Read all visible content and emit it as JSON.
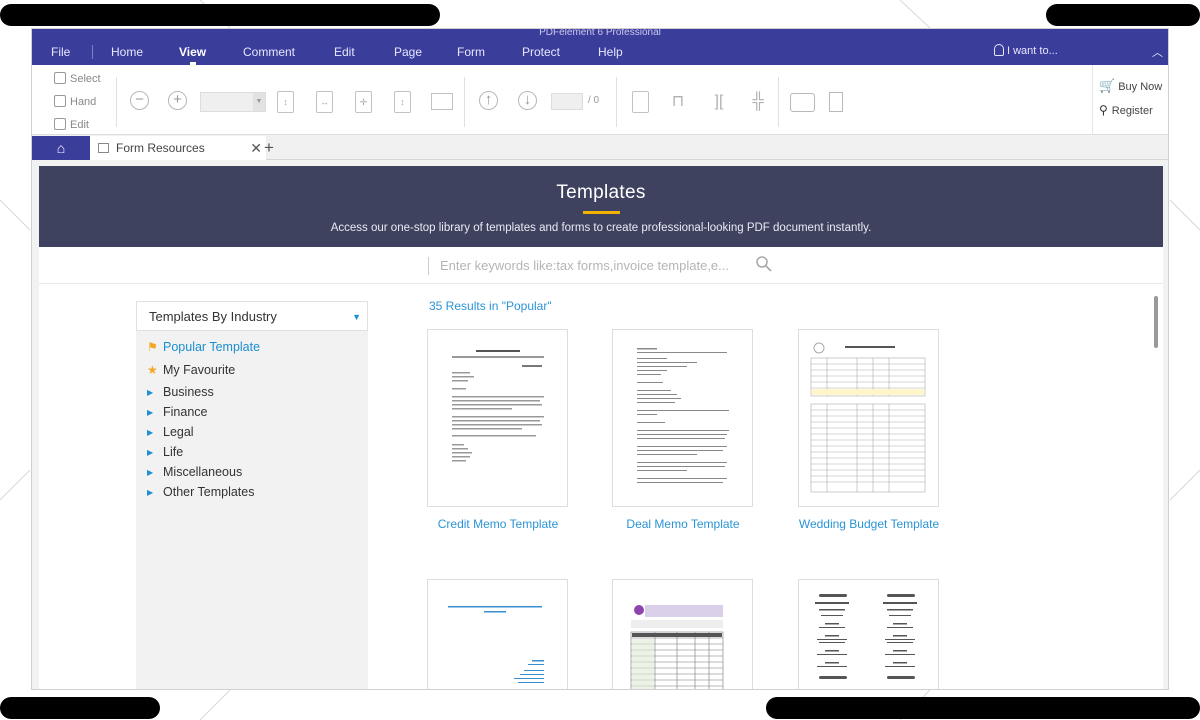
{
  "app": {
    "title": "PDFelement 6 Professional"
  },
  "menu": {
    "items": [
      "File",
      "Home",
      "View",
      "Comment",
      "Edit",
      "Page",
      "Form",
      "Protect",
      "Help"
    ],
    "active": "View",
    "i_want": "I want to..."
  },
  "toolbar": {
    "select_label": "Select",
    "hand_label": "Hand",
    "edit_label": "Edit",
    "page_count": "/ 0",
    "buy_now": "Buy Now",
    "register": "Register"
  },
  "tabs": {
    "doc_tab": "Form Resources"
  },
  "hero": {
    "title": "Templates",
    "subtitle": "Access our one-stop library of templates and forms to create professional-looking PDF document instantly."
  },
  "search": {
    "placeholder": "Enter keywords like:tax forms,invoice template,e..."
  },
  "sidebar": {
    "dropdown_label": "Templates By Industry",
    "categories": [
      "Popular Template",
      "My Favourite",
      "Business",
      "Finance",
      "Legal",
      "Life",
      "Miscellaneous",
      "Other Templates"
    ]
  },
  "results": {
    "summary": "35  Results in \"Popular\""
  },
  "templates": [
    {
      "name": "Credit Memo Template"
    },
    {
      "name": "Deal Memo Template"
    },
    {
      "name": "Wedding Budget Template"
    }
  ],
  "colors": {
    "menu_bar": "#3b3d9b",
    "hero_bg": "#3f425f",
    "accent_yellow": "#f0b400",
    "link_blue": "#2a94d6"
  },
  "icons": [
    "home-icon",
    "lightbulb-icon",
    "cart-icon",
    "key-icon",
    "search-icon",
    "camera-icon",
    "bookmark-icon"
  ]
}
